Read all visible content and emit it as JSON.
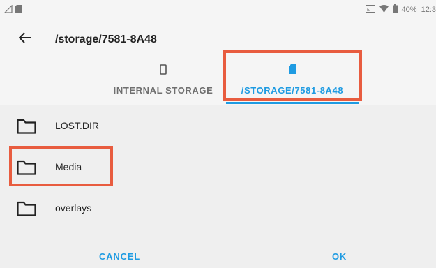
{
  "status_bar": {
    "battery_percent": "40%",
    "time": "12:3",
    "icons": [
      "signal-icon",
      "sd-card-small-icon",
      "cast-icon",
      "wifi-icon",
      "battery-icon"
    ]
  },
  "header": {
    "back_icon": "arrow-left-icon",
    "title": "/storage/7581-8A48"
  },
  "tabs": [
    {
      "label": "INTERNAL STORAGE",
      "icon": "phone-icon",
      "selected": false
    },
    {
      "label": "/STORAGE/7581-8A48",
      "icon": "sd-card-icon",
      "selected": true
    }
  ],
  "folders": [
    {
      "name": "LOST.DIR",
      "icon": "folder-icon"
    },
    {
      "name": "Media",
      "icon": "folder-icon"
    },
    {
      "name": "overlays",
      "icon": "folder-icon"
    }
  ],
  "actions": {
    "cancel_label": "CANCEL",
    "ok_label": "OK"
  },
  "colors": {
    "accent": "#1e9be2",
    "highlight": "#e85c3f",
    "background": "#efefef",
    "header_bg": "#f5f5f5"
  }
}
